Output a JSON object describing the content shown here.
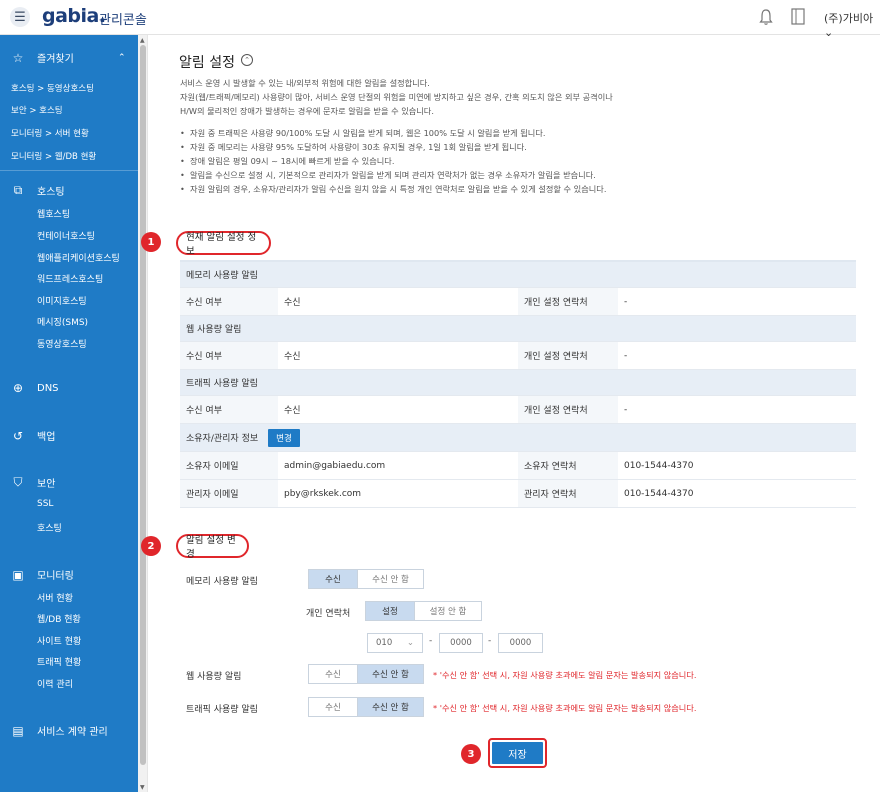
{
  "header": {
    "logo": "gabia.",
    "console_title": "관리콘솔",
    "account": "(주)가비아"
  },
  "sidebar": {
    "favorites_label": "즐겨찾기",
    "favorites": [
      "호스팅 > 동영상호스팅",
      "보안 > 호스팅",
      "모니터링 > 서버 현황",
      "모니터링 > 웹/DB 현황"
    ],
    "hosting_label": "호스팅",
    "hosting_items": [
      "웹호스팅",
      "컨테이너호스팅",
      "웹애플리케이션호스팅",
      "워드프레스호스팅",
      "이미지호스팅",
      "메시징(SMS)",
      "동영상호스팅"
    ],
    "dns_label": "DNS",
    "backup_label": "백업",
    "security_label": "보안",
    "security_items": [
      "SSL",
      "호스팅"
    ],
    "monitoring_label": "모니터링",
    "monitoring_items": [
      "서버 현황",
      "웹/DB 현황",
      "사이트 현황",
      "트래픽 현황",
      "이력 관리"
    ],
    "contract_label": "서비스 계약 관리"
  },
  "page": {
    "title": "알림 설정",
    "desc": [
      "서비스 운영 시 발생할 수 있는 내/외부적 위험에 대한 알림을 설정합니다.",
      "자원(웹/트래픽/메모리) 사용량이 많아, 서비스 운영 단절의 위험을 미연에 방지하고 싶은 경우, 간혹 의도치 않은 외부 공격이나",
      "H/W의 물리적인 장애가 발생하는 경우에 문자로 알림을 받을 수 있습니다."
    ],
    "bullets": [
      "자원 중 트래픽은 사용량 90/100% 도달 시 알림을 받게 되며, 웹은 100% 도달 시 알림을 받게 됩니다.",
      "자원 중 메모리는 사용량 95% 도달하여 사용량이 30초 유지될 경우, 1일 1회 알림을 받게 됩니다.",
      "장애 알림은 평일 09시 ~ 18시에 빠르게 받을 수 있습니다.",
      "알림을 수신으로 설정 시, 기본적으로 관리자가 알림을 받게 되며 관리자 연락처가 없는 경우 소유자가 알림을 받습니다.",
      "자원 알림의 경우, 소유자/관리자가 알림 수신을 원치 않을 시 특정 개인 연락처로 알림을 받을 수 있게 설정할 수 있습니다."
    ]
  },
  "current": {
    "badge": "1",
    "heading": "현재 알림 설정 정보",
    "memory_head": "메모리 사용량 알림",
    "web_head": "웹 사용량 알림",
    "traffic_head": "트래픽 사용량 알림",
    "recv_label": "수신 여부",
    "recv_value": "수신",
    "personal_label": "개인 설정 연락처",
    "personal_value": "-",
    "owner_head": "소유자/관리자 정보",
    "change_btn": "변경",
    "owner_email_label": "소유자 이메일",
    "owner_email": "admin@gabiaedu.com",
    "owner_phone_label": "소유자 연락처",
    "owner_phone": "010-1544-4370",
    "admin_email_label": "관리자 이메일",
    "admin_email": "pby@rkskek.com",
    "admin_phone_label": "관리자 연락처",
    "admin_phone": "010-1544-4370"
  },
  "change": {
    "badge": "2",
    "heading": "알림 설정 변경",
    "memory_label": "메모리 사용량 알림",
    "web_label": "웹 사용량 알림",
    "traffic_label": "트래픽 사용량 알림",
    "recv": "수신",
    "no_recv": "수신 안 함",
    "personal_label": "개인 연락처",
    "set": "설정",
    "no_set": "설정 안 함",
    "phone_prefix": "010",
    "phone_mid": "0000",
    "phone_last": "0000",
    "warn": "* '수신 안 함' 선택 시, 자원 사용량 초과에도 알림 문자는 발송되지 않습니다."
  },
  "save": {
    "badge": "3",
    "label": "저장"
  }
}
